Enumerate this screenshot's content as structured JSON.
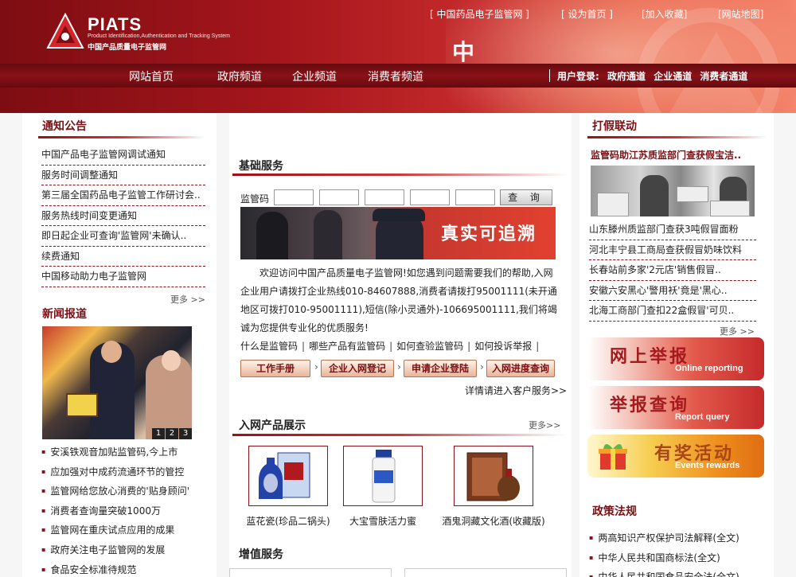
{
  "header": {
    "logo_name": "PIATS",
    "logo_sub_en": "Product Identification,Authentication and Tracking System",
    "logo_sub_cn": "中国产品质量电子监管网",
    "top_links": [
      "[ 中国药品电子监管网 ]",
      "[ 设为首页 ]",
      "[加入收藏]",
      "[网站地图]"
    ],
    "banner_char": "中",
    "nav": [
      "网站首页",
      "政府频道",
      "企业频道",
      "消费者频道"
    ],
    "login_label": "用户登录:",
    "login_channels": [
      "政府通道",
      "企业通道",
      "消费者通道"
    ]
  },
  "left": {
    "notice_title": "通知公告",
    "notices": [
      "中国产品电子监管网调试通知",
      "服务时间调整通知",
      "第三届全国药品电子监管工作研讨会..",
      "服务热线时间变更通知",
      "即日起企业可查询'监管网'未确认..",
      "续费通知",
      "中国移动助力电子监管网"
    ],
    "more": "更多 >>",
    "news_title": "新闻报道",
    "pager": [
      "1",
      "2",
      "3"
    ],
    "news": [
      "安溪铁观音加贴监管码,今上市",
      "应加强对中成药流通环节的管控",
      "监管网给您放心消费的'贴身顾问'",
      "消费者查询量突破1000万",
      "监管网在重庆试点应用的成果",
      "政府关注电子监管网的发展",
      "食品安全标准待规范"
    ]
  },
  "center": {
    "basic_title": "基础服务",
    "code_label": "监管码",
    "query_button": "查 询",
    "banner_text": "真实可追溯",
    "welcome": "欢迎访问中国产品质量电子监管网!如您遇到问题需要我们的帮助,入网企业用户请拨打企业热线010-84607888,消费者请拨打95001111(未开通地区可拨打010-95001111),短信(除小灵通外)-106695001111,我们将竭诚为您提供专业化的优质服务!",
    "faq_links": [
      "什么是监管码",
      "哪些产品有监管码",
      "如何查验监管码",
      "如何投诉举报"
    ],
    "faq_sep": "|",
    "steps": [
      "工作手册",
      "企业入网登记",
      "申请企业登陆",
      "入网进度查询"
    ],
    "step_arrow": "›",
    "detail_link": "详情请进入客户服务>>",
    "products_title": "入网产品展示",
    "products_more": "更多>>",
    "products": [
      "蓝花瓷(珍品二锅头)",
      "大宝雪肤活力蜜",
      "酒鬼洞藏文化酒(收藏版)"
    ],
    "value_title": "增值服务"
  },
  "right": {
    "anti_title": "打假联动",
    "headline": "监管码助江苏质监部门查获假宝洁..",
    "news": [
      "山东滕州质监部门查获3吨假冒面粉",
      "河北丰宁县工商局查获假冒奶味饮料",
      "长春站前多家'2元店'销售假冒..",
      "安徽六安黑心'警用袄'竟是'黑心..",
      "北海工商部门查扣22盒假冒'可贝.."
    ],
    "more": "更多 >>",
    "buttons": [
      {
        "cn": "网上举报",
        "en": "Online reporting"
      },
      {
        "cn": "举报查询",
        "en": "Report query"
      },
      {
        "cn": "有奖活动",
        "en": "Events rewards"
      }
    ],
    "policy_title": "政策法规",
    "policies": [
      "两高知识产权保护司法解释(全文)",
      "中华人民共和国商标法(全文)",
      "中华人民共和国食品安全法(全文)"
    ]
  }
}
